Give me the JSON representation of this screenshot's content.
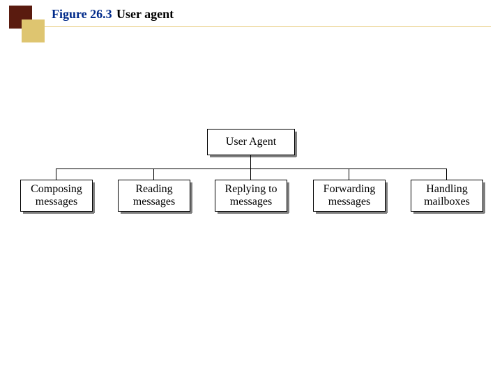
{
  "header": {
    "figure": "Figure 26.3",
    "title": "User agent"
  },
  "chart_data": {
    "type": "diagram",
    "root": "User Agent",
    "children": [
      {
        "line1": "Composing",
        "line2": "messages"
      },
      {
        "line1": "Reading",
        "line2": "messages"
      },
      {
        "line1": "Replying to",
        "line2": "messages"
      },
      {
        "line1": "Forwarding",
        "line2": "messages"
      },
      {
        "line1": "Handling",
        "line2": "mailboxes"
      }
    ]
  }
}
